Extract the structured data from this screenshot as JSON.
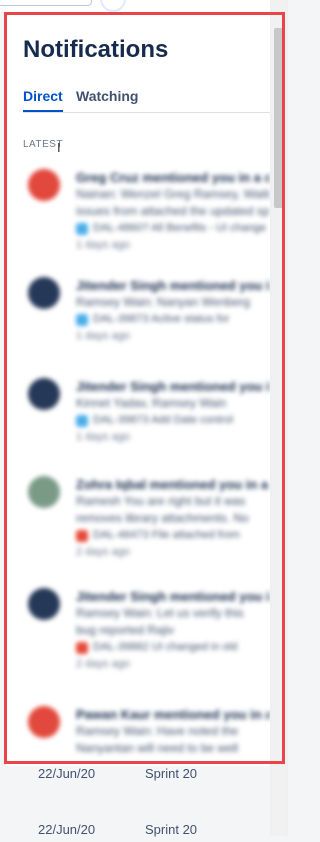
{
  "panel": {
    "title": "Notifications",
    "tabs": [
      "Direct",
      "Watching"
    ],
    "section_label": "LATEST"
  },
  "notifications": [
    {
      "avatar_color": "#e2483d",
      "headline": "Greg Cruz mentioned you in a comment",
      "excerpt": "Nainan: Wenzel Greg Ramsey, Waiting",
      "excerpt2": "issues from attached the updated spec",
      "issue_color": "#4bade8",
      "issue": "DAL-4860? All Benefits - UI change",
      "time": "1 days ago"
    },
    {
      "avatar_color": "#253858",
      "headline": "Jitender Singh mentioned you in a comment",
      "excerpt": "Ramsey Wain: Nanyan Wenberg",
      "excerpt2": "",
      "issue_color": "#4bade8",
      "issue": "DAL-39873 Active status for",
      "time": "1 days ago"
    },
    {
      "avatar_color": "#253858",
      "headline": "Jitender Singh mentioned you in a comment",
      "excerpt": "Kinnet Yadav, Ramsey Wain",
      "excerpt2": "",
      "issue_color": "#4bade8",
      "issue": "DAL-39873 Add Date control",
      "time": "1 days ago"
    },
    {
      "avatar_color": "#7a9a86",
      "headline": "Zohra Iqbal mentioned you in a comment",
      "excerpt": "Ramesh You are right but it was",
      "excerpt2": "removes library attachments. No",
      "issue_color": "#e5493a",
      "issue": "DAL-46473 File attached from",
      "time": "2 days ago"
    },
    {
      "avatar_color": "#253858",
      "headline": "Jitender Singh mentioned you in a comment",
      "excerpt": "Ramsey Wain: Let us verify this",
      "excerpt2": "bug reported Rajiv",
      "issue_color": "#e5493a",
      "issue": "DAL-39882 UI changed in old",
      "time": "2 days ago"
    },
    {
      "avatar_color": "#e2483d",
      "headline": "Pawan Kaur mentioned you in a comment",
      "excerpt": "Ramsey Wain: Have noted the",
      "excerpt2": "Nanyantan will need to be well",
      "issue_color": "#4bade8",
      "issue": "",
      "time": ""
    }
  ],
  "background_rows": [
    {
      "date": "22/Jun/20",
      "sprint": "Sprint 20"
    },
    {
      "date": "22/Jun/20",
      "sprint": "Sprint 20"
    }
  ]
}
